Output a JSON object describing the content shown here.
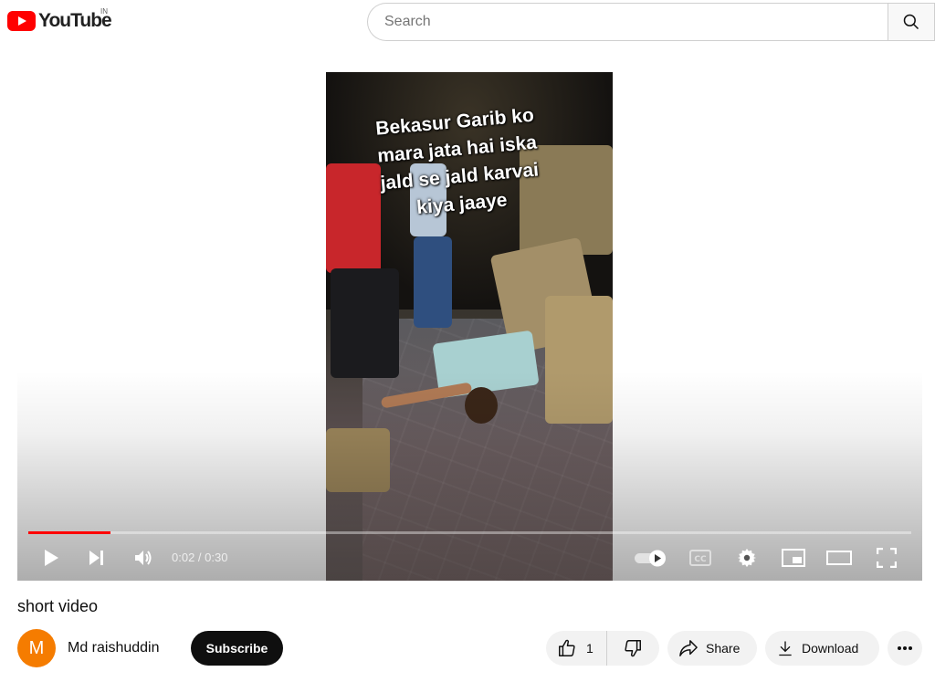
{
  "header": {
    "logo_text": "YouTube",
    "country_code": "IN",
    "search_placeholder": "Search"
  },
  "player": {
    "caption": "Bekasur Garib ko\nmara jata hai iska\njald se jald karvai\nkiya jaaye",
    "current_time": "0:02",
    "duration": "0:30",
    "time_display": "0:02 / 0:30",
    "progress_fraction": 0.093,
    "autoplay_on": true
  },
  "video": {
    "title": "short video"
  },
  "channel": {
    "avatar_letter": "M",
    "name": "Md raishuddin",
    "subscribe_label": "Subscribe"
  },
  "actions": {
    "like_count": "1",
    "share_label": "Share",
    "download_label": "Download"
  },
  "colors": {
    "brand_red": "#ff0000",
    "avatar": "#f57c00",
    "subscribe_bg": "#0f0f0f"
  }
}
